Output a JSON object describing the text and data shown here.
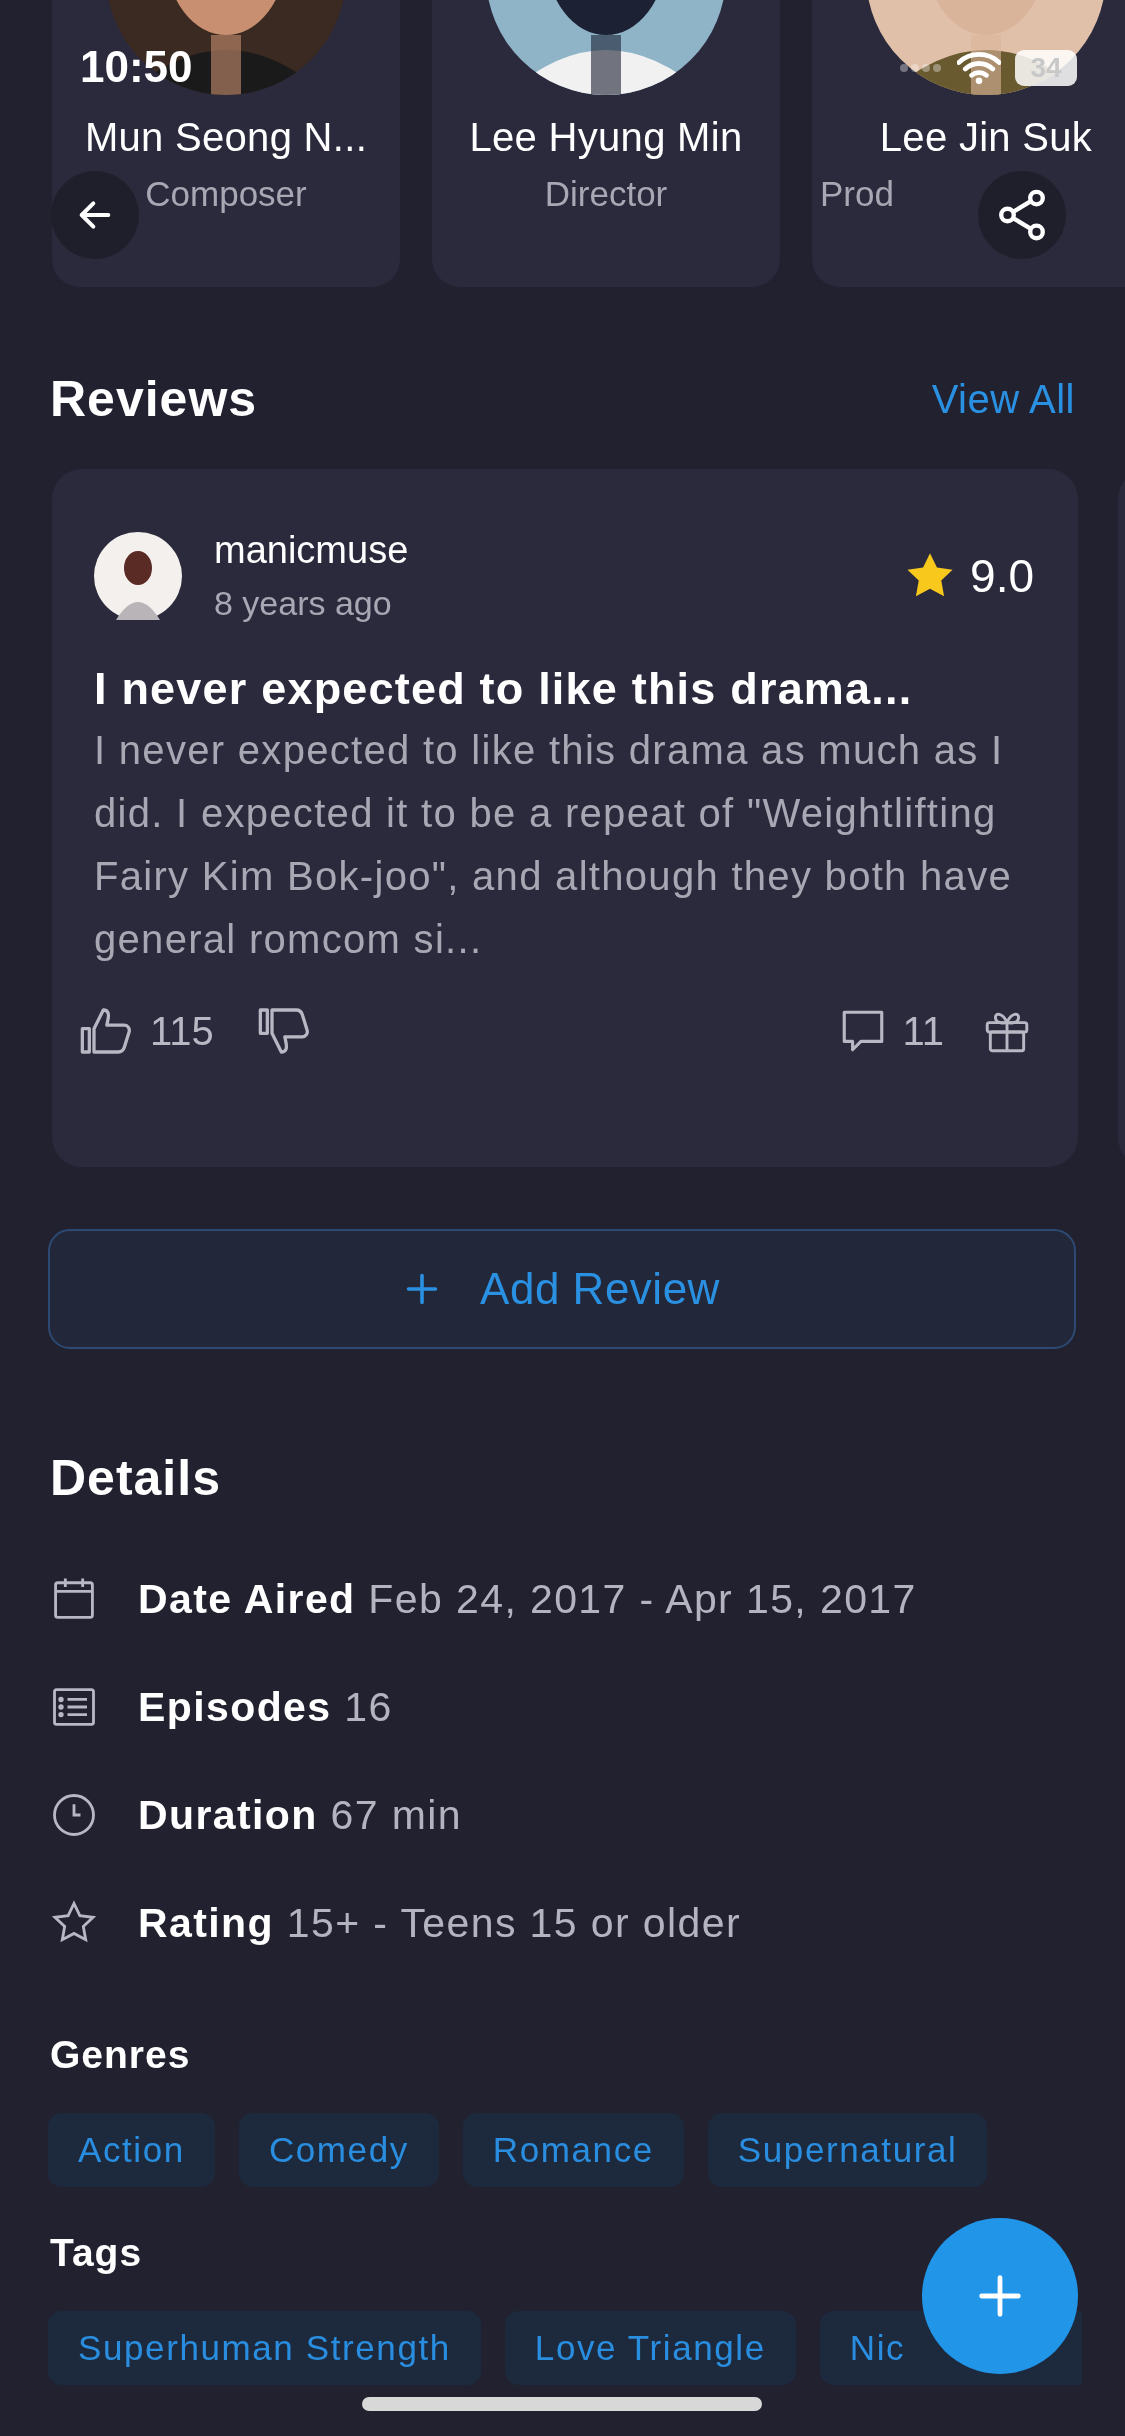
{
  "status_bar": {
    "time": "10:50",
    "battery": "34"
  },
  "cast": [
    {
      "name": "Mun Seong N...",
      "role": "Composer"
    },
    {
      "name": "Lee Hyung Min",
      "role": "Director"
    },
    {
      "name": "Lee Jin Suk",
      "role": "Prod"
    }
  ],
  "reviews": {
    "title": "Reviews",
    "view_all": "View All",
    "items": [
      {
        "user": "manicmuse",
        "time": "8 years ago",
        "score": "9.0",
        "headline": "I never expected to like this drama...",
        "body": "I never expected to like this drama as much as I did. I expected it to be a repeat of \"Weightlifting Fairy Kim Bok-joo\", and although they both have general romcom si...",
        "likes": "115",
        "comments": "11"
      }
    ]
  },
  "add_review": "Add Review",
  "details": {
    "title": "Details",
    "rows": [
      {
        "kind": "calendar",
        "label": "Date Aired",
        "value": "Feb 24, 2017 - Apr 15, 2017"
      },
      {
        "kind": "list",
        "label": "Episodes",
        "value": "16"
      },
      {
        "kind": "clock",
        "label": "Duration",
        "value": "67 min"
      },
      {
        "kind": "star",
        "label": "Rating",
        "value": "15+ - Teens 15 or older"
      }
    ]
  },
  "genres": {
    "title": "Genres",
    "items": [
      "Action",
      "Comedy",
      "Romance",
      "Supernatural"
    ]
  },
  "tags": {
    "title": "Tags",
    "items": [
      "Superhuman Strength",
      "Love Triangle",
      "Nic"
    ]
  }
}
